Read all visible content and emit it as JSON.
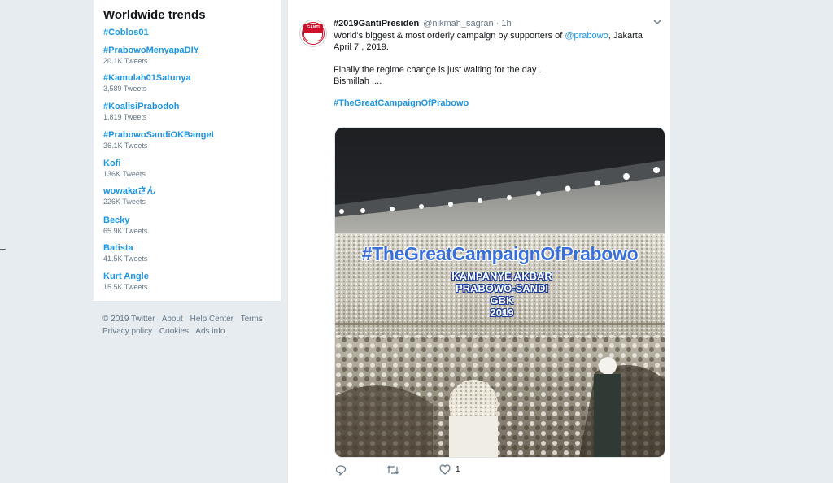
{
  "trends": {
    "title": "Worldwide trends",
    "items": [
      {
        "name": "#Coblos01",
        "count": ""
      },
      {
        "name": "#PrabowoMenyapaDIY",
        "count": "20.1K Tweets"
      },
      {
        "name": "#Kamulah01Satunya",
        "count": "3,589 Tweets"
      },
      {
        "name": "#KoalisiPrabodoh",
        "count": "1,819 Tweets"
      },
      {
        "name": "#PrabowoSandiOKBanget",
        "count": "36.1K Tweets"
      },
      {
        "name": "Kofi",
        "count": "136K Tweets"
      },
      {
        "name": "wowakaさん",
        "count": "226K Tweets"
      },
      {
        "name": "Becky",
        "count": "65.9K Tweets"
      },
      {
        "name": "Batista",
        "count": "41.5K Tweets"
      },
      {
        "name": "Kurt Angle",
        "count": "15.5K Tweets"
      }
    ]
  },
  "footer": {
    "copyright": "© 2019 Twitter",
    "about": "About",
    "help": "Help Center",
    "terms": "Terms",
    "privacy": "Privacy policy",
    "cookies": "Cookies",
    "ads": "Ads info"
  },
  "tweet": {
    "name": "#2019GantiPresiden",
    "handle": "@nikmah_sagran",
    "time": "· 1h",
    "text_1a": "World's biggest & most orderly campaign by supporters of ",
    "mention": "@prabowo",
    "text_1b": ", Jakarta April 7 , 2019.",
    "text_2": "Finally the regime change is just waiting for the day .",
    "text_3": "Bismillah ....",
    "hashtag": "#TheGreatCampaignOfPrabowo",
    "image": {
      "overlay_title": "#TheGreatCampaignOfPrabowo",
      "overlay_lines": [
        "KAMPANYE AKBAR",
        "PRABOWO-SANDI",
        "GBK",
        "2019"
      ]
    },
    "avatar_text": "GANTI",
    "likes": "1"
  },
  "colors": {
    "link": "#1b95e0",
    "background": "#e6ecf0",
    "muted": "#657786"
  }
}
